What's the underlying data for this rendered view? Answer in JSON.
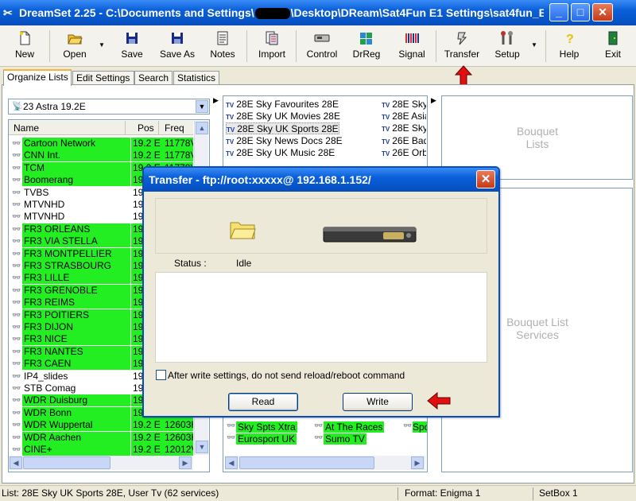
{
  "window": {
    "title_prefix": "DreamSet 2.25 - C:\\Documents and Settings\\",
    "title_suffix": "\\Desktop\\DReam\\Sat4Fun E1 Settings\\sat4fun_E1...",
    "minimize": "_",
    "maximize": "□",
    "close": "✕"
  },
  "toolbar": {
    "items": [
      {
        "label": "New",
        "icon": "new-file-icon"
      },
      {
        "label": "Open",
        "icon": "open-folder-icon"
      },
      {
        "label": "Save",
        "icon": "save-disk-icon"
      },
      {
        "label": "Save As",
        "icon": "save-as-disk-icon"
      },
      {
        "label": "Notes",
        "icon": "notes-icon"
      },
      {
        "label": "Import",
        "icon": "import-icon"
      },
      {
        "label": "Control",
        "icon": "control-icon"
      },
      {
        "label": "DrReg",
        "icon": "drreg-icon"
      },
      {
        "label": "Signal",
        "icon": "signal-icon"
      },
      {
        "label": "Transfer",
        "icon": "transfer-icon"
      },
      {
        "label": "Setup",
        "icon": "setup-tools-icon"
      },
      {
        "label": "Help",
        "icon": "help-icon"
      },
      {
        "label": "Exit",
        "icon": "exit-door-icon"
      }
    ]
  },
  "tabs": [
    "Organize Lists",
    "Edit Settings",
    "Search",
    "Statistics"
  ],
  "satellite_select": "23 Astra 19.2E",
  "channel_list": {
    "columns": [
      "Name",
      "Pos",
      "Freq"
    ],
    "rows": [
      {
        "name": "Cartoon Network",
        "pos": "19.2 E",
        "freq": "11778V",
        "hl": true
      },
      {
        "name": "CNN Int.",
        "pos": "19.2 E",
        "freq": "11778V",
        "hl": true
      },
      {
        "name": "TCM",
        "pos": "19.2 E",
        "freq": "11778V",
        "hl": true
      },
      {
        "name": "Boomerang",
        "pos": "19.2 E",
        "freq": "11778V",
        "hl": true
      },
      {
        "name": "TVBS",
        "pos": "19.",
        "freq": "",
        "hl": false
      },
      {
        "name": "MTVNHD",
        "pos": "19.",
        "freq": "",
        "hl": false
      },
      {
        "name": "MTVNHD",
        "pos": "19.",
        "freq": "",
        "hl": false
      },
      {
        "name": "FR3 ORLEANS",
        "pos": "19.",
        "freq": "",
        "hl": true
      },
      {
        "name": "FR3 VIA STELLA",
        "pos": "19.",
        "freq": "",
        "hl": true
      },
      {
        "name": "FR3 MONTPELLIER",
        "pos": "19.",
        "freq": "",
        "hl": true
      },
      {
        "name": "FR3 STRASBOURG",
        "pos": "19.",
        "freq": "",
        "hl": true
      },
      {
        "name": "FR3 LILLE",
        "pos": "19.",
        "freq": "",
        "hl": true
      },
      {
        "name": "FR3 GRENOBLE",
        "pos": "19.",
        "freq": "",
        "hl": true
      },
      {
        "name": "FR3 REIMS",
        "pos": "19.",
        "freq": "",
        "hl": true
      },
      {
        "name": "FR3 POITIERS",
        "pos": "19.",
        "freq": "",
        "hl": true
      },
      {
        "name": "FR3 DIJON",
        "pos": "19.",
        "freq": "",
        "hl": true
      },
      {
        "name": "FR3 NICE",
        "pos": "19.",
        "freq": "",
        "hl": true
      },
      {
        "name": "FR3 NANTES",
        "pos": "19.",
        "freq": "",
        "hl": true
      },
      {
        "name": "FR3 CAEN",
        "pos": "19.",
        "freq": "",
        "hl": true
      },
      {
        "name": "IP4_slides",
        "pos": "19.",
        "freq": "",
        "hl": false
      },
      {
        "name": "STB Comag",
        "pos": "19.",
        "freq": "",
        "hl": false
      },
      {
        "name": "WDR Duisburg",
        "pos": "19.",
        "freq": "",
        "hl": true
      },
      {
        "name": "WDR Bonn",
        "pos": "19.",
        "freq": "",
        "hl": true
      },
      {
        "name": "WDR Wuppertal",
        "pos": "19.2 E",
        "freq": "12603H",
        "hl": true
      },
      {
        "name": "WDR Aachen",
        "pos": "19.2 E",
        "freq": "12603H",
        "hl": true
      },
      {
        "name": "CINE+",
        "pos": "19.2 E",
        "freq": "12012V",
        "hl": true
      }
    ]
  },
  "bouquets_col1": [
    "28E Sky Favourites 28E",
    "28E Sky UK Movies 28E",
    "28E Sky UK Sports 28E",
    "28E Sky News Docs 28E",
    "28E Sky UK Music 28E"
  ],
  "bouquets_col2": [
    "28E Sky",
    "28E Asia",
    "28E Sky",
    "26E Bad",
    "26E Orb"
  ],
  "bouquet_lists_placeholder": "Bouquet\nLists",
  "bouquet_services_placeholder": "Bouquet List\nServices",
  "services_bottom": [
    {
      "name": "Sky Spts Xtra"
    },
    {
      "name": "At The Races"
    },
    {
      "name": "Spo"
    },
    {
      "name": "Eurosport UK"
    },
    {
      "name": "Sumo TV"
    }
  ],
  "dialog": {
    "title": "Transfer - ftp://root:xxxxx@ 192.168.1.152/",
    "status_label": "Status :",
    "status_value": "Idle",
    "checkbox_label": "After write settings, do not send reload/reboot command",
    "read_button": "Read",
    "write_button": "Write"
  },
  "statusbar": {
    "list": "List: 28E Sky UK Sports 28E, User Tv (62 services)",
    "format": "Format: Enigma 1",
    "setbox": "SetBox 1"
  }
}
